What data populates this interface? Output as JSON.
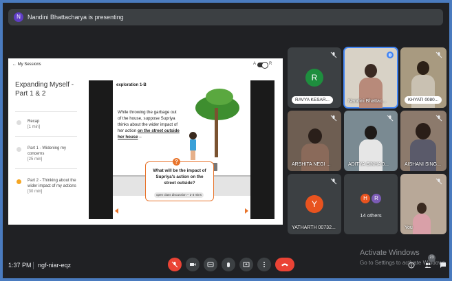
{
  "presenter": {
    "avatar_letter": "N",
    "text": "Nandini Bhattacharya is presenting"
  },
  "share": {
    "back_label": "My Sessions",
    "toggle_left": "A",
    "toggle_right": "R",
    "session_title": "Expanding Myself - Part 1 & 2",
    "steps": [
      {
        "label": "Recap",
        "time": "[1 min]"
      },
      {
        "label": "Part 1 - Widening my concerns",
        "time": "[25 min]"
      },
      {
        "label": "Part 2 - Thinking about the wider impact of my actions",
        "time": "[30 min]"
      }
    ],
    "slide": {
      "title": "exploration 1-B",
      "story_pre": "While throwing the garbage out of the house, suppose Supriya thinks about the wider impact of her action",
      "story_link": "on the street outside her house",
      "story_post": " –",
      "question": "What will be the impact of Supriya's action on the street outside?",
      "pill": "open class discussion – 2-3 mins"
    }
  },
  "tiles": [
    {
      "name": "RAVYA KESAR...",
      "avatar": "R",
      "color": "#1e8e3e"
    },
    {
      "name": "Nandini Bhattac...",
      "speaking": true
    },
    {
      "name": "KHYATI 0080..."
    },
    {
      "name": "ARSHITA NEGI ..."
    },
    {
      "name": "ADITYA SINHA 0..."
    },
    {
      "name": "AISHANI SING..."
    },
    {
      "name": "YATHARTH 00732...",
      "avatar": "Y",
      "color": "#e8531f"
    },
    {
      "name": "14 others",
      "avatars": [
        "H",
        "R"
      ]
    },
    {
      "name": "You"
    }
  ],
  "bottom": {
    "time": "1:37 PM",
    "code": "ngf-niar-eqz",
    "participants_count": "23"
  },
  "watermark": {
    "line1": "Activate Windows",
    "line2": "Go to Settings to activate Windows."
  },
  "colors": {
    "accent": "#4285f4",
    "hangup": "#ea4335",
    "slide_accent": "#e8742c"
  }
}
